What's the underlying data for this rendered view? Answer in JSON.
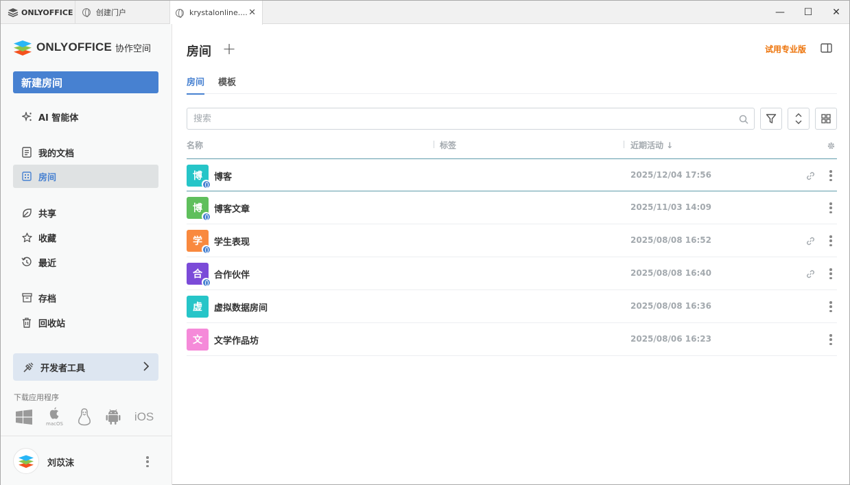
{
  "titlebar": {
    "home_tab": "ONLYOFFICE",
    "tabs": [
      {
        "label": "创建门户"
      },
      {
        "label": "krystalonline...."
      }
    ],
    "minimize": "—",
    "maximize": "☐",
    "close": "✕",
    "tab_close": "✕"
  },
  "sidebar": {
    "brand_name": "ONLYOFFICE",
    "brand_sub": "协作空间",
    "new_room": "新建房间",
    "items": [
      {
        "label": "AI 智能体"
      },
      {
        "label": "我的文档"
      },
      {
        "label": "房间"
      },
      {
        "label": "共享"
      },
      {
        "label": "收藏"
      },
      {
        "label": "最近"
      },
      {
        "label": "存档"
      },
      {
        "label": "回收站"
      }
    ],
    "dev_tools": "开发者工具",
    "download_label": "下载应用程序",
    "apps": {
      "macos": "macOS",
      "ios": "iOS"
    },
    "user_name": "刘苡沫"
  },
  "main": {
    "title": "房间",
    "add_symbol": "+",
    "trial": "试用专业版",
    "tabs": [
      {
        "label": "房间",
        "active": true
      },
      {
        "label": "模板",
        "active": false
      }
    ],
    "search_placeholder": "搜索",
    "columns": {
      "name": "名称",
      "tags": "标签",
      "activity": "近期活动 ↓"
    },
    "rows": [
      {
        "initial": "博",
        "name": "博客",
        "date": "2025/12/04 17:56",
        "color": "#26c5c8",
        "public": true,
        "link": true
      },
      {
        "initial": "博",
        "name": "博客文章",
        "date": "2025/11/03 14:09",
        "color": "#5fbf5c",
        "public": true,
        "link": false
      },
      {
        "initial": "学",
        "name": "学生表现",
        "date": "2025/08/08 16:52",
        "color": "#f9893e",
        "public": true,
        "link": true
      },
      {
        "initial": "合",
        "name": "合作伙伴",
        "date": "2025/08/08 16:40",
        "color": "#7b4bd8",
        "public": true,
        "link": true
      },
      {
        "initial": "虚",
        "name": "虚拟数据房间",
        "date": "2025/08/08 16:36",
        "color": "#26c5c8",
        "public": false,
        "link": false
      },
      {
        "initial": "文",
        "name": "文学作品坊",
        "date": "2025/08/06 16:23",
        "color": "#f58ad9",
        "public": false,
        "link": false
      }
    ]
  },
  "colors": {
    "accent": "#4781d1",
    "trial": "#ed7309"
  }
}
